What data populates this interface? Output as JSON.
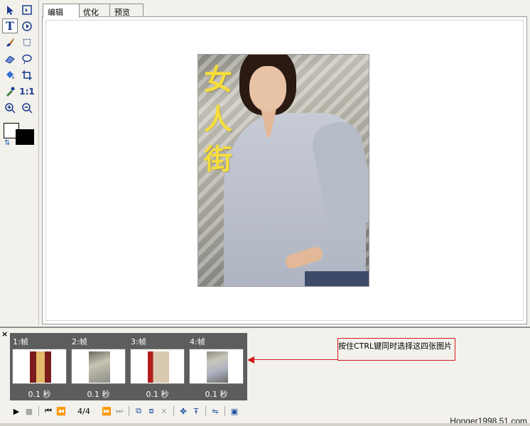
{
  "tabs": [
    {
      "label": "编辑"
    },
    {
      "label": "优化"
    },
    {
      "label": "预览"
    }
  ],
  "toolbox": {
    "tools": [
      {
        "name": "pointer-arrow-icon",
        "glyph": "➤"
      },
      {
        "name": "select-subselection-icon",
        "glyph": "⬚"
      },
      {
        "name": "text-tool-icon",
        "glyph": "T"
      },
      {
        "name": "rotate-icon",
        "glyph": "⟳"
      },
      {
        "name": "brush-icon",
        "glyph": "✎"
      },
      {
        "name": "lasso-icon",
        "glyph": "⚹"
      },
      {
        "name": "eraser-icon",
        "glyph": "▱"
      },
      {
        "name": "oval-lasso-icon",
        "glyph": "◯"
      },
      {
        "name": "fill-bucket-icon",
        "glyph": "◆"
      },
      {
        "name": "crop-icon",
        "glyph": "⌗"
      },
      {
        "name": "eyedropper-icon",
        "glyph": "✐"
      },
      {
        "name": "actual-size-icon",
        "glyph": "1:1"
      },
      {
        "name": "zoom-in-icon",
        "glyph": "⊕"
      },
      {
        "name": "zoom-out-icon",
        "glyph": "⊖"
      }
    ],
    "colors": {
      "foreground": "#ffffff",
      "background": "#000000"
    }
  },
  "canvas": {
    "vertical_text": "女人街",
    "text_color": "#f5dd3c"
  },
  "frames": [
    {
      "label": "1:帧",
      "delay": "0.1 秒"
    },
    {
      "label": "2:帧",
      "delay": "0.1 秒"
    },
    {
      "label": "3:帧",
      "delay": "0.1 秒"
    },
    {
      "label": "4:帧",
      "delay": "0.1 秒"
    }
  ],
  "annotation": {
    "text": "按住CTRL键同时选择这四张图片",
    "color": "#d21b1b"
  },
  "controls": {
    "counter": "4/4"
  },
  "watermark": "Honger1998.51.com"
}
